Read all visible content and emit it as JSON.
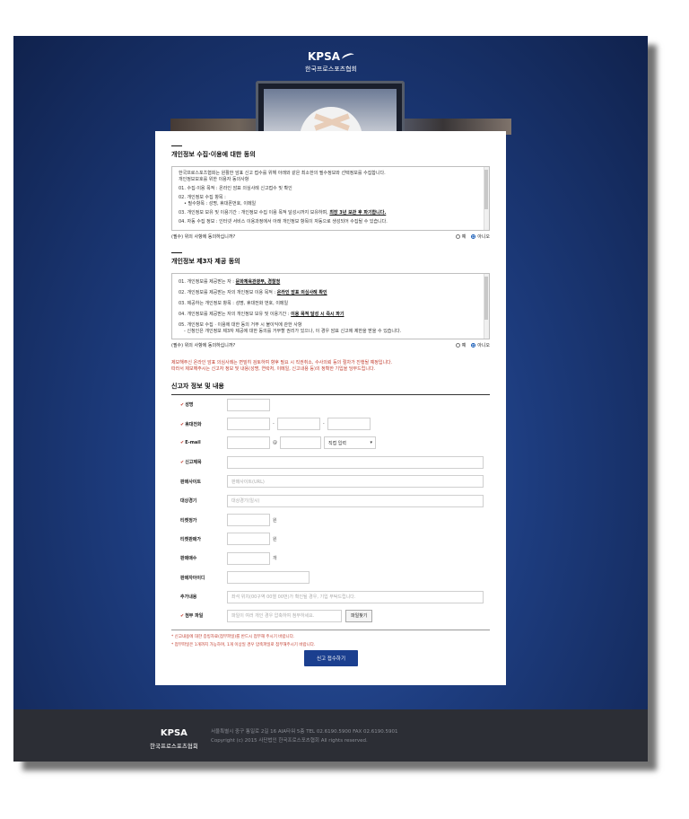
{
  "brand": {
    "logo": "KPSA",
    "name": "한국프로스포츠협회"
  },
  "section1": {
    "title": "개인정보 수집·이용에 대한 동의",
    "intro": "한국프로스포츠협회는 원활한 암표 신고 접수를 위해 아래와 같은 최소한의 필수정보와 선택정보를 수집합니다.",
    "intro2": "개인정보보호를 위한 이용자 동의사항",
    "items": [
      "01. 수집·이용 목적 : 온라인 암표 의심사례 신고접수 및 확인",
      "02. 개인정보 수집 항목 :",
      "• 필수항목 : 성명, 휴대폰번호, 이메일",
      "03. 개인정보 보유 및 이용기간 : 개인정보 수집 이용 목적 달성시까지 보유하며,",
      "최장 3년 보관 후 파기합니다.",
      "04. 자동 수집 정보 : 인터넷 서비스 이용과정에서 아래 개인정보 항목이 자동으로 생성되어 수집될 수 있습니다."
    ],
    "agree_q": "(필수) 위의 사항에 동의하십니까?",
    "yes": "예",
    "no": "아니오"
  },
  "section2": {
    "title": "개인정보 제3자 제공 동의",
    "items": [
      {
        "pre": "01. 개인정보를 제공받는 자 : ",
        "u": "문화체육관광부, 경찰청"
      },
      {
        "pre": "02. 개인정보를 제공받는 자의 개인정보 이용 목적 : ",
        "u": "온라인 암표 의심사례 확인"
      },
      {
        "pre": "03. 제공하는 개인정보 항목 : 성명, 휴대전화 번호, 이메일",
        "u": ""
      },
      {
        "pre": "04. 개인정보를 제공받는 자의 개인정보 보유 및 이용기간 : ",
        "u": "이용 목적 달성 시 즉시 파기"
      },
      {
        "pre": "05. 개인정보 수집 · 이용에 대한 동의 거부 시 불이익에 관한 사항",
        "u": ""
      },
      {
        "pre": "- 신청인은 개인정보 제3자 제공에 대한 동의를 거부할 권리가 있으나, 이 경우 암표 신고에 제한을 받을 수 있습니다.",
        "u": ""
      }
    ],
    "agree_q": "(필수) 위의 사항에 동의하십니까?",
    "yes": "예",
    "no": "아니오"
  },
  "notice": [
    "제보해주신 온라인 암표 의심사례는 면밀히 검토하여 향후 필요 시 직권취소, 수사의뢰 등의 절차가 진행될 예정입니다.",
    "따라서 제보해주시는 신고자 정보 및 내용(성명, 연락처, 이메일, 신고내용 등)의 정확한 기입을 당부드립니다."
  ],
  "form": {
    "title": "신고자 정보 및 내용",
    "name_label": "성명",
    "phone_label": "휴대전화",
    "email_label": "E-mail",
    "email_at": "@",
    "email_select": "직접 입력",
    "subject_label": "신고제목",
    "site_label": "판매사이트",
    "site_ph": "판매사이트(URL)",
    "game_label": "대상경기",
    "game_ph": "대상경기(일시)",
    "face_label": "티켓정가",
    "sale_label": "티켓판매가",
    "unit_won": "원",
    "qty_label": "판매매수",
    "unit_qty": "개",
    "seller_label": "판매자아이디",
    "extra_label": "추가내용",
    "extra_ph": "좌석 위치(00구역 00열 00번)가 확인될 경우, 기입 부탁드립니다.",
    "file_label": "첨부 파일",
    "file_ph": "파일이 여러 개인 경우 압축하여 첨부하세요.",
    "file_btn": "파일찾기",
    "note1": "* 신고내용에 대한 증빙자료(첨부파일)를 반드시 첨부해 주시기 바랍니다.",
    "note2": "* 첨부파일은 1개까지 가능하며, 1개 이상일 경우 압축파일로 첨부해주시기 바랍니다.",
    "submit": "신고 접수하기"
  },
  "footer": {
    "address": "서울특별시 중구 통일로 2길 16 AIA타워 5층   TEL 02.6190.5900   FAX 02.6190.5901",
    "copyright": "Copyright (c) 2015 사단법인 한국프로스포츠협회 All rights reserved."
  }
}
